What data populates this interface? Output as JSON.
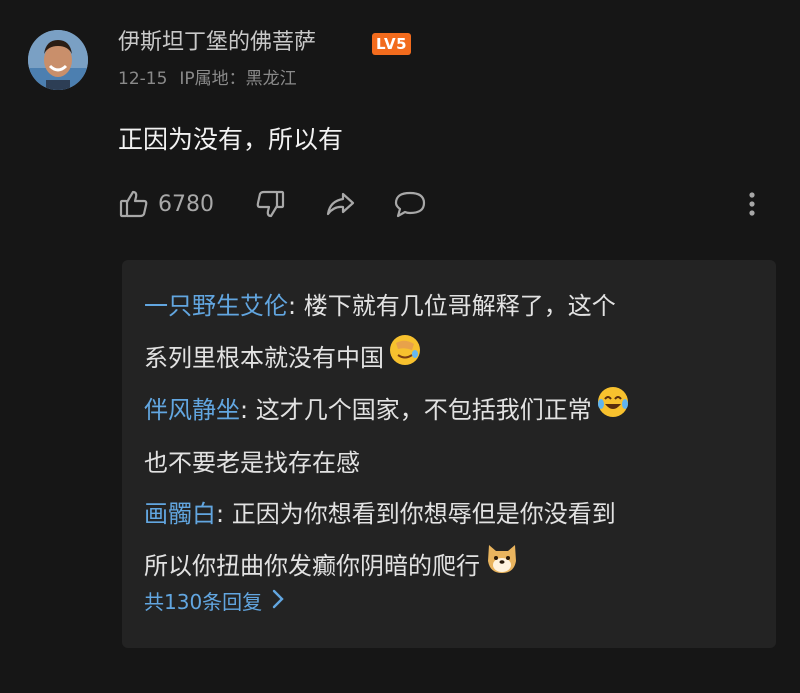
{
  "comment": {
    "username": "伊斯坦丁堡的佛菩萨",
    "level_badge": "LV5",
    "date": "12-15",
    "ip_location": "IP属地：黑龙江",
    "text": "正因为没有，所以有",
    "like_count": "6780",
    "icons": {
      "like": "thumbs-up-icon",
      "dislike": "thumbs-down-icon",
      "share": "share-icon",
      "reply": "comment-bubble-icon",
      "more": "more-vertical-icon"
    },
    "level_badge_color": "#f26b1d"
  },
  "replies": {
    "items": [
      {
        "author": "一只野生艾伦",
        "separator": ": ",
        "text_line1": "楼下就有几位哥解释了，这个",
        "text_line2": "系列里根本就没有中国",
        "emoji": "facepalm-emoji"
      },
      {
        "author": "伴风静坐",
        "separator": ": ",
        "text_line1": "这才几个国家，不包括我们正常",
        "text_line2": "也不要老是找存在感",
        "emoji": "tears-of-joy-emoji"
      },
      {
        "author": "画髑白",
        "separator": ": ",
        "text_line1": "正因为你想看到你想辱但是你没看到",
        "text_line2": "所以你扭曲你发癫你阴暗的爬行",
        "emoji": "doge-emoji"
      }
    ],
    "total_label": "共130条回复",
    "author_color": "#62a6e0"
  }
}
